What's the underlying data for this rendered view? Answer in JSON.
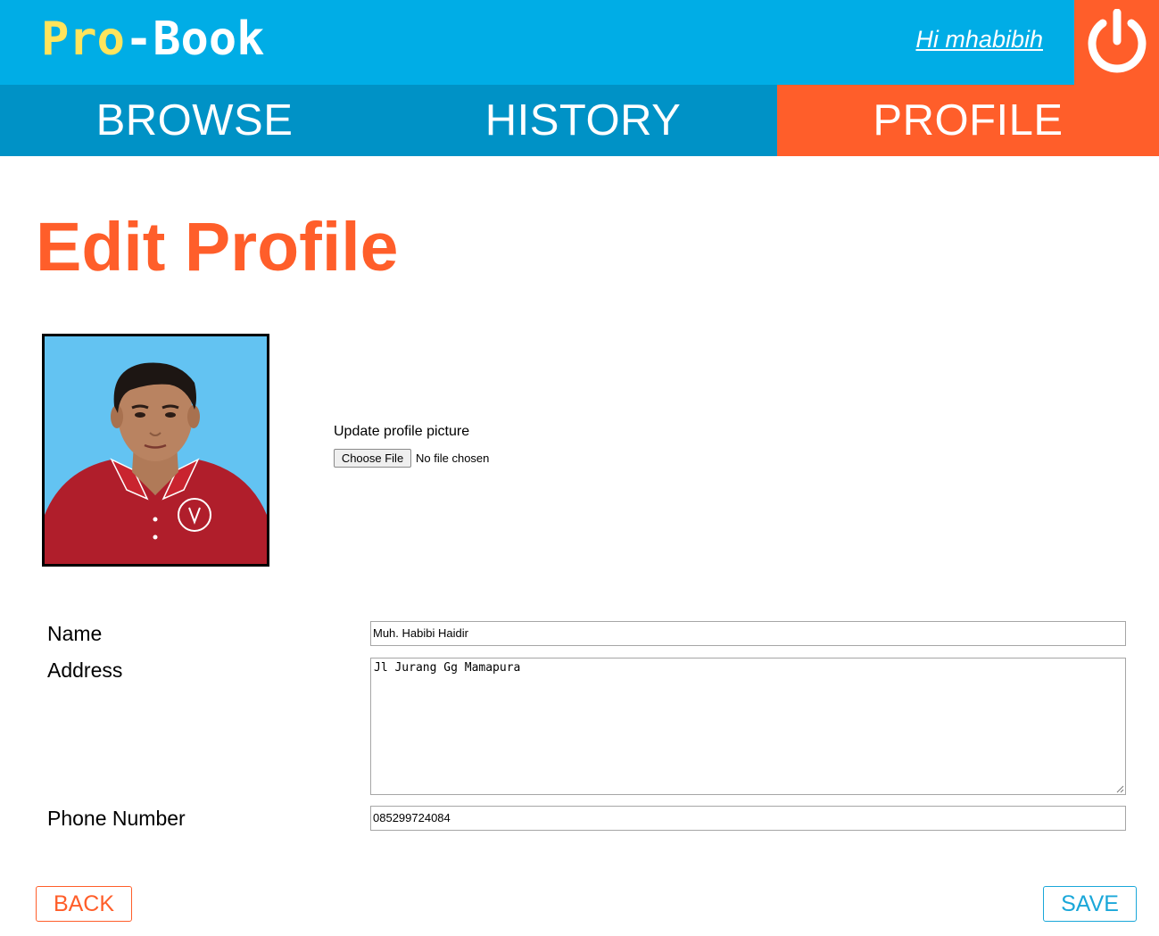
{
  "header": {
    "logo_part1": "Pro",
    "logo_part2": "-Book",
    "greeting": "Hi mhabibih",
    "logout_icon": "power-icon"
  },
  "nav": {
    "tabs": [
      {
        "label": "BROWSE",
        "active": false
      },
      {
        "label": "HISTORY",
        "active": false
      },
      {
        "label": "PROFILE",
        "active": true
      }
    ]
  },
  "main": {
    "title": "Edit Profile",
    "profile_picture": {
      "update_label": "Update profile picture",
      "choose_button": "Choose File",
      "file_status": "No file chosen"
    },
    "form": {
      "name_label": "Name",
      "name_value": "Muh. Habibi Haidir",
      "address_label": "Address",
      "address_value": "Jl Jurang Gg Mamapura",
      "phone_label": "Phone Number",
      "phone_value": "085299724084"
    },
    "back_label": "BACK",
    "save_label": "SAVE"
  },
  "colors": {
    "header_blue": "#00ADE6",
    "nav_blue": "#0092C6",
    "accent_orange": "#FF5E2A",
    "logo_yellow": "#FFE45C",
    "save_blue": "#1AA7D9"
  }
}
